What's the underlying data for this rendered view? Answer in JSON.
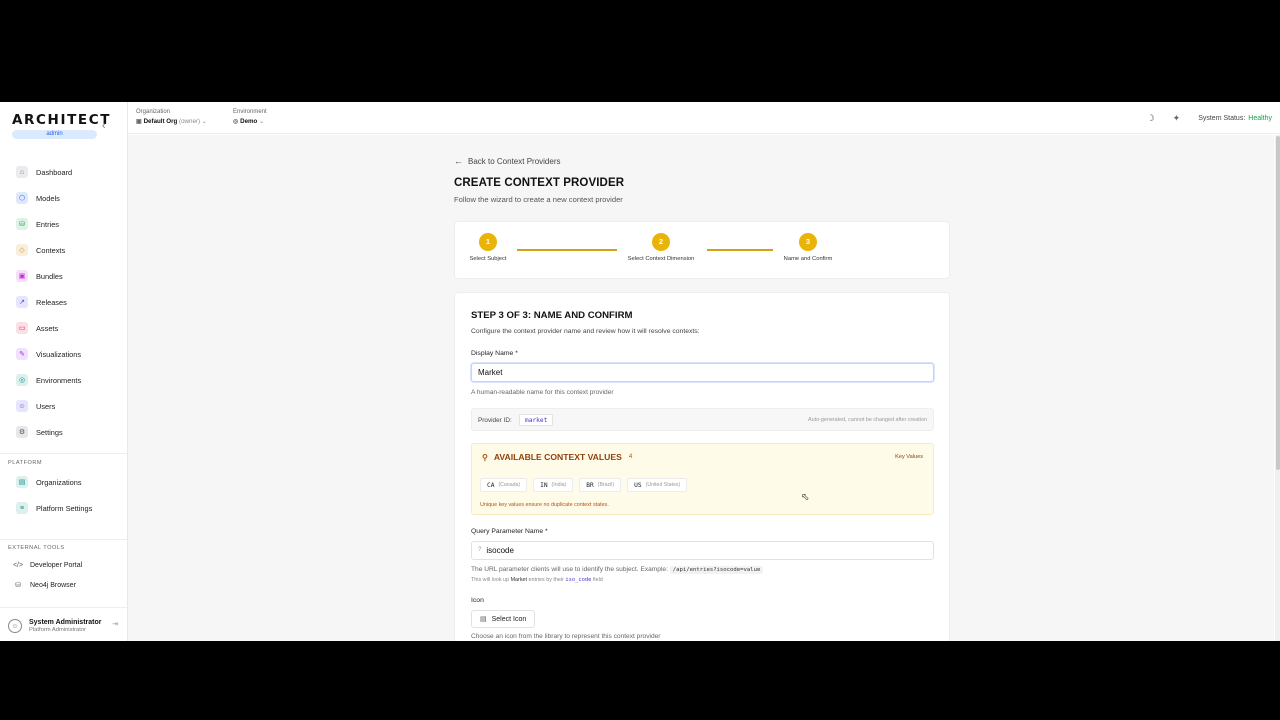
{
  "brand": {
    "logo": "ARCHITECT",
    "role": "admin"
  },
  "sidebar": {
    "items": [
      {
        "label": "Dashboard",
        "icon": "home-icon",
        "color": "#6b7280"
      },
      {
        "label": "Models",
        "icon": "cube-icon",
        "color": "#2563eb"
      },
      {
        "label": "Entries",
        "icon": "database-icon",
        "color": "#16a34a"
      },
      {
        "label": "Contexts",
        "icon": "tag-icon",
        "color": "#ca8a04"
      },
      {
        "label": "Bundles",
        "icon": "layers-icon",
        "color": "#c026d3"
      },
      {
        "label": "Releases",
        "icon": "rocket-icon",
        "color": "#4f46e5"
      },
      {
        "label": "Assets",
        "icon": "folder-icon",
        "color": "#e11d48"
      },
      {
        "label": "Visualizations",
        "icon": "brush-icon",
        "color": "#9333ea"
      },
      {
        "label": "Environments",
        "icon": "globe-icon",
        "color": "#0d9488"
      },
      {
        "label": "Users",
        "icon": "users-icon",
        "color": "#4f46e5"
      },
      {
        "label": "Settings",
        "icon": "gear-icon",
        "color": "#4b5563"
      }
    ],
    "platform_label": "PLATFORM",
    "platform_items": [
      {
        "label": "Organizations",
        "icon": "building-icon",
        "color": "#0d9488"
      },
      {
        "label": "Platform Settings",
        "icon": "sliders-icon",
        "color": "#0d9488"
      }
    ],
    "external_label": "EXTERNAL TOOLS",
    "external_items": [
      {
        "label": "Developer Portal",
        "icon": "code-icon"
      },
      {
        "label": "Neo4j Browser",
        "icon": "database-icon"
      }
    ],
    "user": {
      "name": "System Administrator",
      "role": "Platform Administrator"
    }
  },
  "topbar": {
    "org_label": "Organization",
    "org_value": "Default Org",
    "org_role": "(owner)",
    "env_label": "Environment",
    "env_value": "Demo",
    "status_label": "System Status:",
    "status_value": "Healthy",
    "status_color": "#16a34a"
  },
  "page": {
    "back": "Back to Context Providers",
    "title": "CREATE CONTEXT PROVIDER",
    "subtitle": "Follow the wizard to create a new context provider"
  },
  "steps": [
    {
      "number": "1",
      "label": "Select Subject"
    },
    {
      "number": "2",
      "label": "Select Context Dimension"
    },
    {
      "number": "3",
      "label": "Name and Confirm"
    }
  ],
  "form": {
    "heading": "STEP 3 OF 3: NAME AND CONFIRM",
    "description": "Configure the context provider name and review how it will resolve contexts:",
    "display_name_label": "Display Name *",
    "display_name_value": "Market",
    "display_name_help": "A human-readable name for this context provider",
    "provider_id_label": "Provider ID:",
    "provider_id_value": "market",
    "provider_id_note": "Auto-generated, cannot be changed after creation",
    "available_title": "AVAILABLE CONTEXT VALUES",
    "available_count": "4",
    "available_tag": "Key Values",
    "values": [
      {
        "code": "CA",
        "country": "(Canada)"
      },
      {
        "code": "IN",
        "country": "(India)"
      },
      {
        "code": "BR",
        "country": "(Brazil)"
      },
      {
        "code": "US",
        "country": "(United States)"
      }
    ],
    "available_note": "Unique key values ensure no duplicate context states.",
    "query_label": "Query Parameter Name *",
    "query_value": "isocode",
    "query_help": "The URL parameter clients will use to identify the subject. Example:",
    "query_example": "/api/entries?isocode=value",
    "lookup_prefix": "This will look up",
    "lookup_entity": "Market",
    "lookup_mid": "entries by their",
    "lookup_field": "iso_code",
    "lookup_suffix": "field",
    "icon_label": "Icon",
    "icon_button": "Select Icon",
    "icon_help": "Choose an icon from the library to represent this context provider"
  }
}
